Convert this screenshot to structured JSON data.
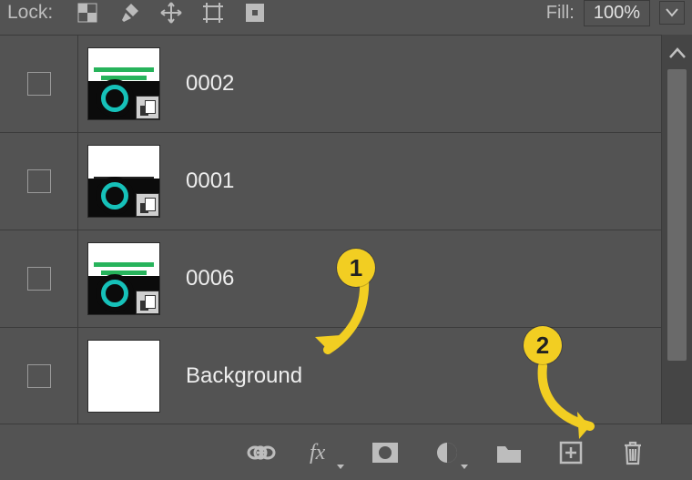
{
  "toolbar": {
    "lock_label": "Lock:",
    "fill_label": "Fill:",
    "fill_value": "100%",
    "icons": [
      "transparency-lock",
      "brush-lock",
      "move-lock",
      "artboard-lock",
      "all-lock"
    ]
  },
  "layers": [
    {
      "name": "0002",
      "thumb_style": "hat-disc",
      "smart": true
    },
    {
      "name": "0001",
      "thumb_style": "text-disc",
      "smart": true
    },
    {
      "name": "0006",
      "thumb_style": "hat-disc",
      "smart": true
    },
    {
      "name": "Background",
      "thumb_style": "blank",
      "smart": false
    }
  ],
  "bottom_buttons": [
    "link",
    "fx",
    "mask",
    "adjustment",
    "group",
    "new-layer",
    "trash"
  ],
  "annotations": {
    "one": "1",
    "two": "2"
  }
}
